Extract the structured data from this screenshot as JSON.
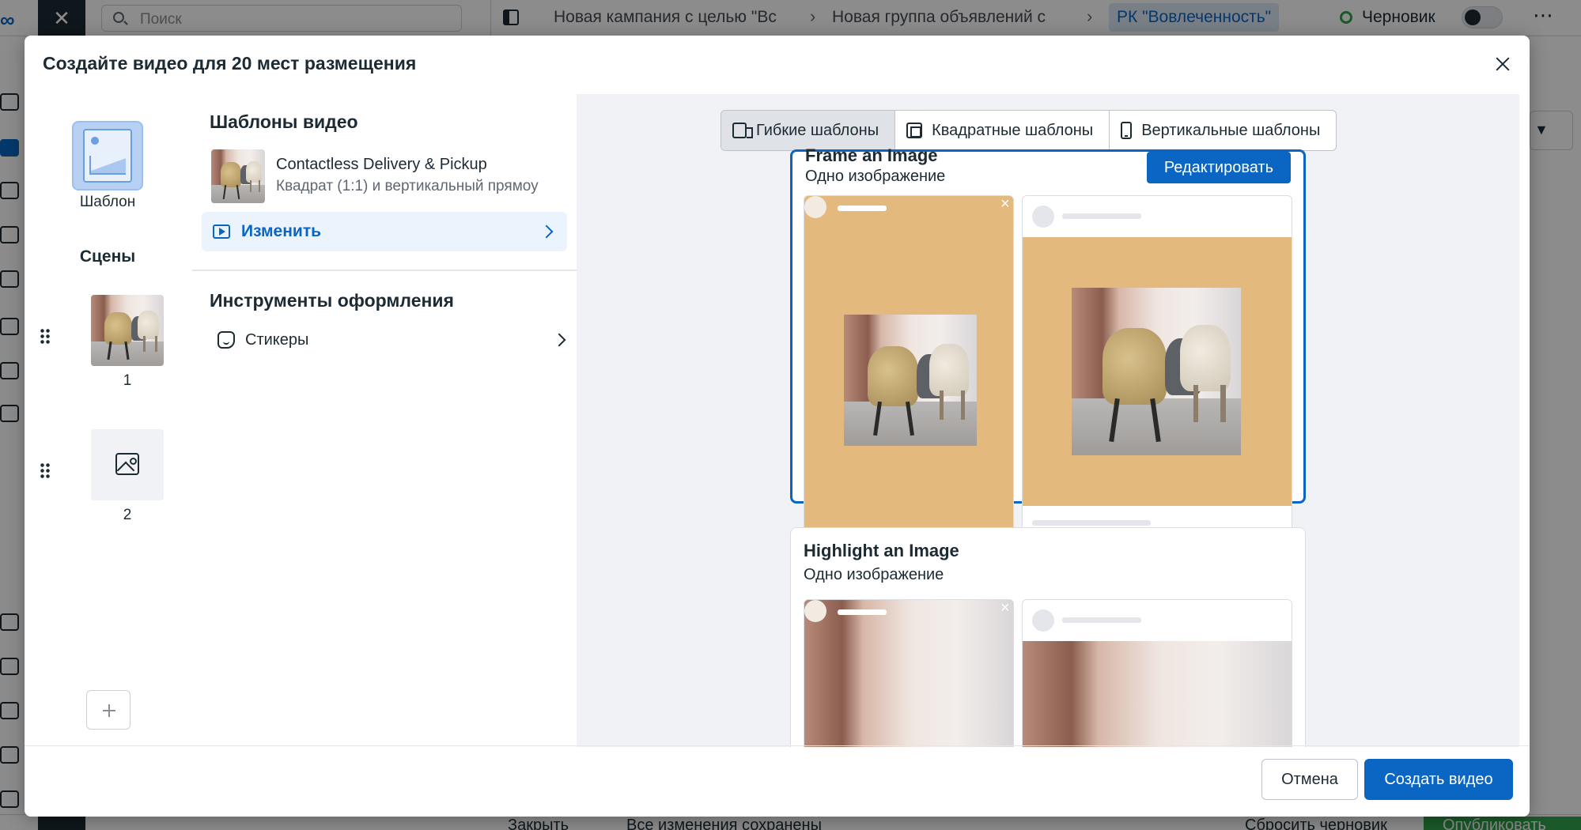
{
  "app": {
    "search_placeholder": "Поиск",
    "breadcrumbs": [
      "Новая кампания с целью \"Вс",
      "Новая группа объявлений с",
      "РК \"Вовлеченность\""
    ],
    "status": "Черновик",
    "bottom_bar": {
      "close": "Закрыть",
      "saved": "Все изменения сохранены",
      "reset_draft": "Сбросить черновик",
      "publish": "Опубликовать"
    }
  },
  "modal": {
    "title": "Создайте видео для 20 мест размещения",
    "left": {
      "template_label": "Шаблон",
      "scenes_title": "Сцены",
      "scenes": [
        {
          "number": "1",
          "has_image": true
        },
        {
          "number": "2",
          "has_image": false
        }
      ]
    },
    "templates_section": {
      "title": "Шаблоны видео",
      "template_name": "Contactless Delivery & Pickup",
      "template_desc": "Квадрат (1:1) и вертикальный прямоу",
      "change_label": "Изменить"
    },
    "tools_section": {
      "title": "Инструменты оформления",
      "stickers_label": "Стикеры"
    },
    "preview": {
      "tabs": [
        {
          "label": "Гибкие шаблоны",
          "icon": "flexible-template-icon",
          "active": true
        },
        {
          "label": "Квадратные шаблоны",
          "icon": "square-template-icon",
          "active": false
        },
        {
          "label": "Вертикальные шаблоны",
          "icon": "vertical-template-icon",
          "active": false
        }
      ],
      "cards": [
        {
          "title": "Frame an Image",
          "subtitle": "Одно изображение",
          "selected": true,
          "edit_label": "Редактировать"
        },
        {
          "title": "Highlight an Image",
          "subtitle": "Одно изображение",
          "selected": false
        }
      ]
    },
    "footer": {
      "cancel_label": "Отмена",
      "create_label": "Создать видео"
    }
  },
  "colors": {
    "accent": "#0a66c2",
    "template_bg": "#e4b97d",
    "active_tab_bg": "#dfe2e6",
    "change_row_bg": "#ebf3fc"
  }
}
